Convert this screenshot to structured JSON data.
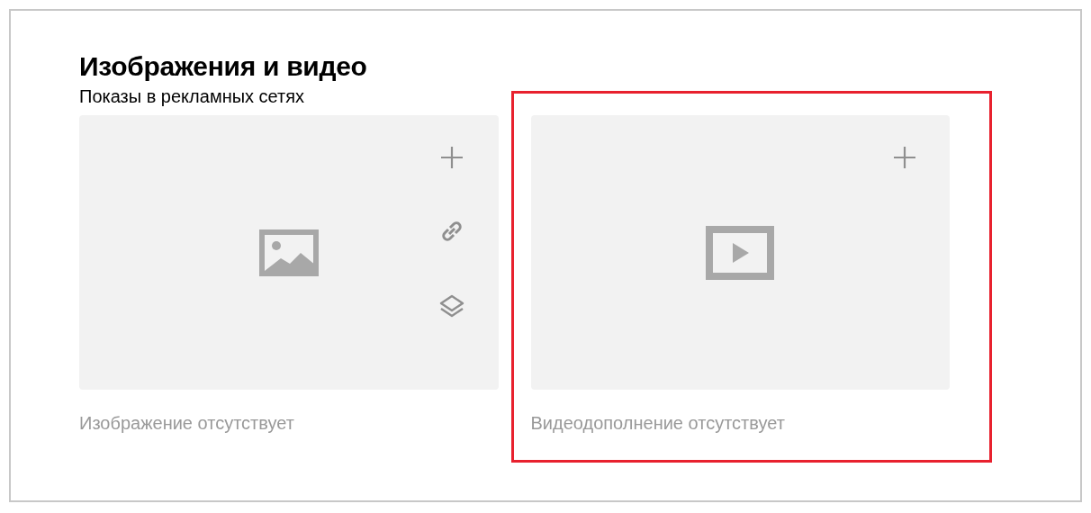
{
  "title": "Изображения и видео",
  "subtitle": "Показы в рекламных сетях",
  "cards": [
    {
      "kind": "image",
      "caption": "Изображение отсутствует",
      "highlighted": false,
      "actions": [
        {
          "kind": "add"
        },
        {
          "kind": "link"
        },
        {
          "kind": "layers"
        }
      ]
    },
    {
      "kind": "video",
      "caption": "Видеодополнение отсутствует",
      "highlighted": true,
      "actions": [
        {
          "kind": "add"
        }
      ]
    }
  ]
}
